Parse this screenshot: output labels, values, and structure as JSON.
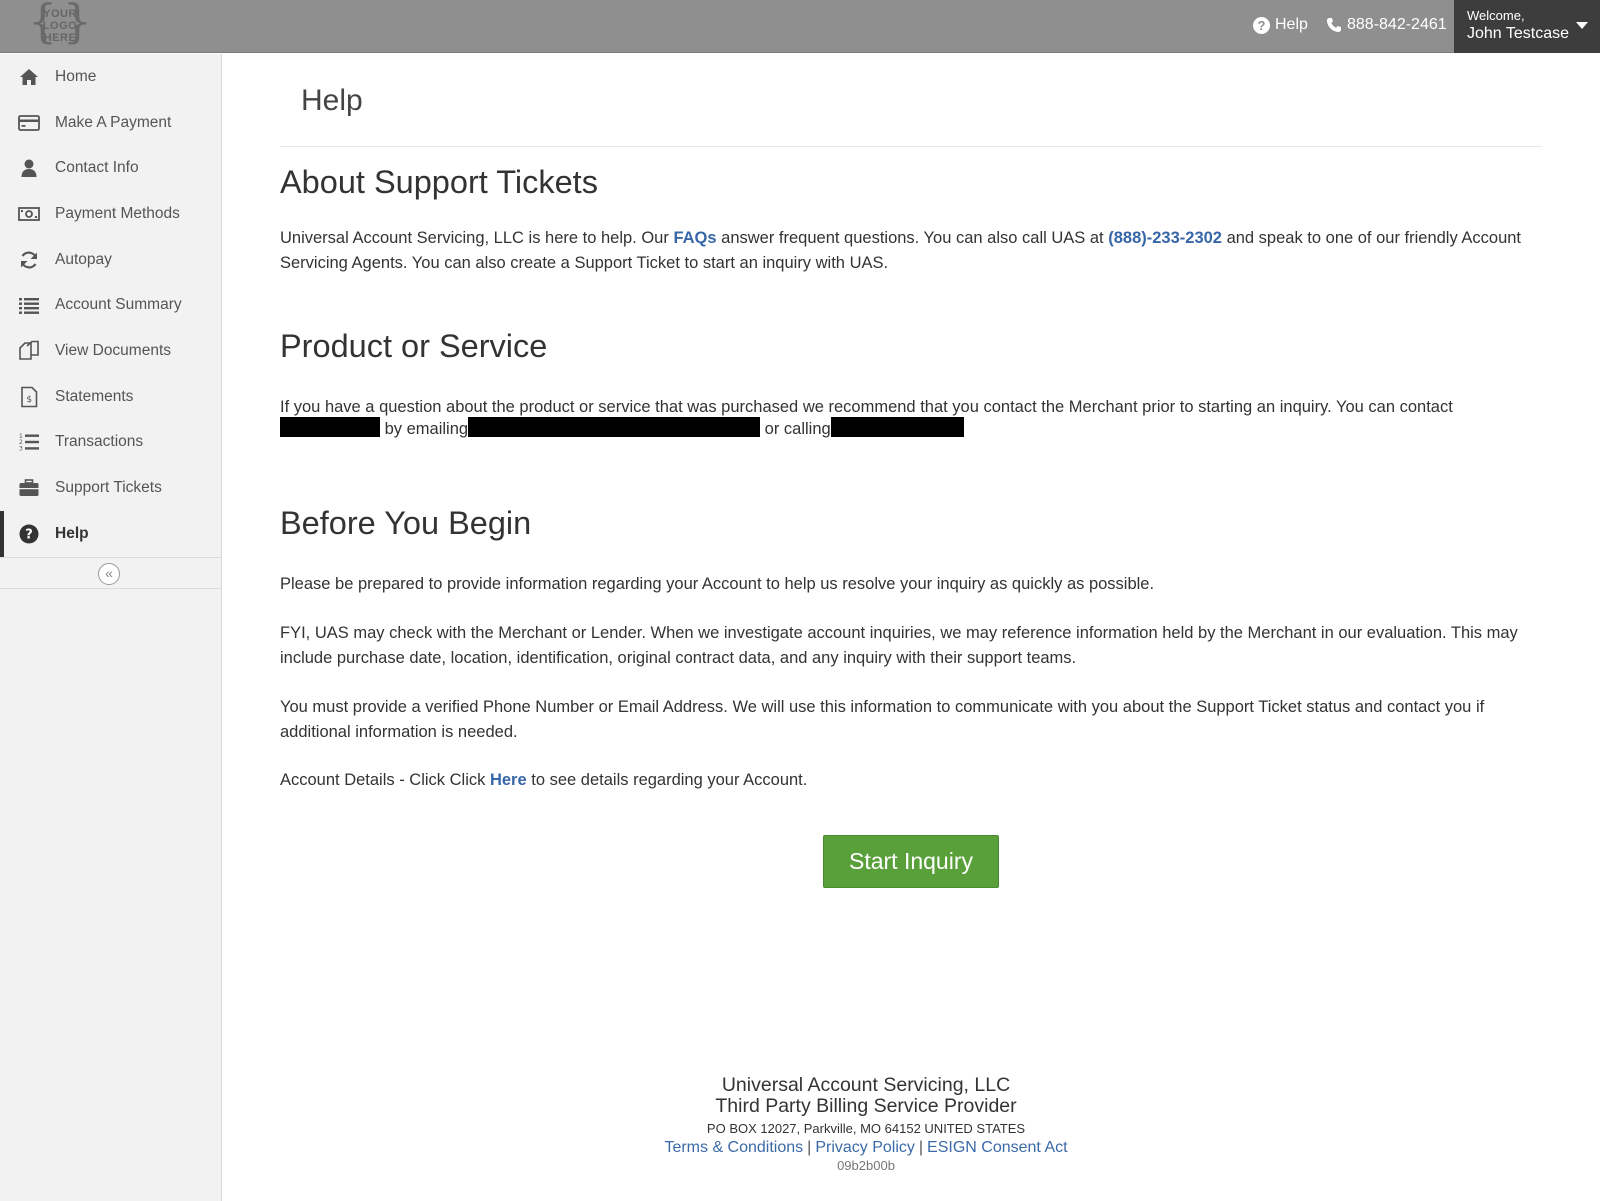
{
  "header": {
    "logo_line1": "YOUR",
    "logo_line2": "LOGO",
    "logo_line3": "HERE",
    "help_label": "Help",
    "phone": "888-842-2461",
    "welcome_label": "Welcome,",
    "user_name": "John Testcase"
  },
  "sidebar": {
    "items": [
      {
        "label": "Home",
        "icon": "home-icon"
      },
      {
        "label": "Make A Payment",
        "icon": "credit-card-icon"
      },
      {
        "label": "Contact Info",
        "icon": "user-icon"
      },
      {
        "label": "Payment Methods",
        "icon": "money-icon"
      },
      {
        "label": "Autopay",
        "icon": "refresh-icon"
      },
      {
        "label": "Account Summary",
        "icon": "list-icon"
      },
      {
        "label": "View Documents",
        "icon": "documents-icon"
      },
      {
        "label": "Statements",
        "icon": "statement-icon"
      },
      {
        "label": "Transactions",
        "icon": "ordered-list-icon"
      },
      {
        "label": "Support Tickets",
        "icon": "briefcase-icon"
      },
      {
        "label": "Help",
        "icon": "question-circle-icon"
      }
    ],
    "collapse_glyph": "«"
  },
  "main": {
    "page_title": "Help",
    "about": {
      "heading": "About Support Tickets",
      "text_1": "Universal Account Servicing, LLC is here to help. Our ",
      "faqs_link": "FAQs",
      "text_2": " answer frequent questions. You can also call UAS at ",
      "phone_link": "(888)-233-2302",
      "text_3": " and speak to one of our friendly Account Servicing Agents. You can also create a Support Ticket to start an inquiry with UAS."
    },
    "product": {
      "heading": "Product or Service",
      "text_1": "If you have a question about the product or service that was purchased we recommend that you contact the Merchant prior to starting an inquiry. You can contact",
      "text_2": "by emailing",
      "text_3": "or calling"
    },
    "before": {
      "heading": "Before You Begin",
      "para_1": "Please be prepared to provide information regarding your Account to help us resolve your inquiry as quickly as possible.",
      "para_2": "FYI, UAS may check with the Merchant or Lender. When we investigate account inquiries, we may reference information held by the Merchant in our evaluation. This may include purchase date, location, identification, original contract data, and any inquiry with their support teams.",
      "para_3": "You must provide a verified Phone Number or Email Address. We will use this information to communicate with you about the Support Ticket status and contact you if additional information is needed.",
      "details_1": "Account Details - Click Click ",
      "details_link": "Here",
      "details_2": " to see details regarding your Account."
    },
    "start_button": "Start Inquiry"
  },
  "footer": {
    "company": "Universal Account Servicing, LLC",
    "tagline": "Third Party Billing Service Provider",
    "address": "PO BOX 12027, Parkville, MO 64152 UNITED STATES",
    "terms": "Terms & Conditions",
    "privacy": "Privacy Policy",
    "esign": "ESIGN Consent Act",
    "separator": "|",
    "build": "09b2b00b"
  },
  "colors": {
    "topbar": "#8f8f8f",
    "welcome_bg": "#3d3d3d",
    "link": "#3766a8",
    "button": "#5aa03a"
  }
}
